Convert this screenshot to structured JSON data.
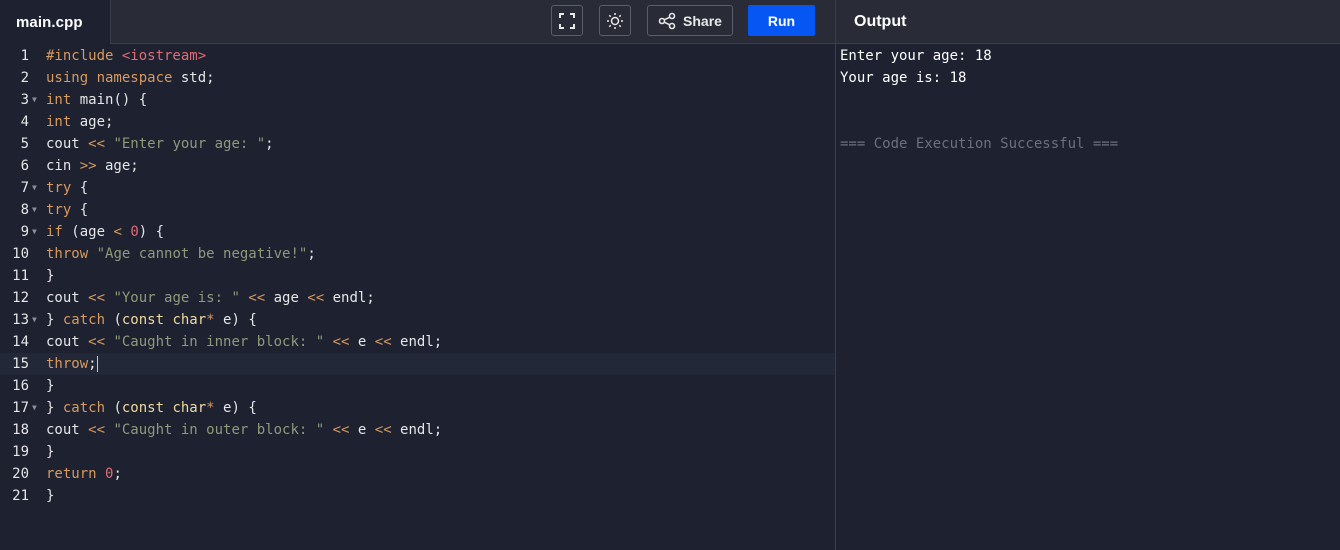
{
  "file_tab": "main.cpp",
  "toolbar": {
    "fullscreen_icon": "fullscreen-icon",
    "theme_icon": "sun-icon",
    "share_label": "Share",
    "run_label": "Run"
  },
  "output_panel": {
    "title": "Output",
    "lines": [
      "Enter your age: 18",
      "Your age is: 18",
      "",
      "",
      "=== Code Execution Successful ==="
    ]
  },
  "editor": {
    "active_line": 15,
    "lines": [
      {
        "n": "1",
        "fold": false,
        "tokens": [
          [
            "pp",
            "#include "
          ],
          [
            "str",
            "<iostream>"
          ]
        ]
      },
      {
        "n": "2",
        "fold": false,
        "tokens": [
          [
            "kw",
            "using namespace"
          ],
          [
            "t",
            " std;"
          ]
        ]
      },
      {
        "n": "3",
        "fold": true,
        "tokens": [
          [
            "kw",
            "int"
          ],
          [
            "t",
            " main() {"
          ]
        ]
      },
      {
        "n": "4",
        "fold": false,
        "tokens": [
          [
            "kw",
            "int"
          ],
          [
            "t",
            " age;"
          ]
        ]
      },
      {
        "n": "5",
        "fold": false,
        "tokens": [
          [
            "t",
            "cout "
          ],
          [
            "op",
            "<<"
          ],
          [
            "t",
            " "
          ],
          [
            "s",
            "\"Enter your age: \""
          ],
          [
            "t",
            ";"
          ]
        ]
      },
      {
        "n": "6",
        "fold": false,
        "tokens": [
          [
            "t",
            "cin "
          ],
          [
            "op",
            ">>"
          ],
          [
            "t",
            " age;"
          ]
        ]
      },
      {
        "n": "7",
        "fold": true,
        "tokens": [
          [
            "kw",
            "try"
          ],
          [
            "t",
            " {"
          ]
        ]
      },
      {
        "n": "8",
        "fold": true,
        "tokens": [
          [
            "kw",
            "try"
          ],
          [
            "t",
            " {"
          ]
        ]
      },
      {
        "n": "9",
        "fold": true,
        "tokens": [
          [
            "kw",
            "if"
          ],
          [
            "t",
            " (age "
          ],
          [
            "op",
            "<"
          ],
          [
            "t",
            " "
          ],
          [
            "num",
            "0"
          ],
          [
            "t",
            ") {"
          ]
        ]
      },
      {
        "n": "10",
        "fold": false,
        "tokens": [
          [
            "kw",
            "throw"
          ],
          [
            "t",
            " "
          ],
          [
            "s",
            "\"Age cannot be negative!\""
          ],
          [
            "t",
            ";"
          ]
        ]
      },
      {
        "n": "11",
        "fold": false,
        "tokens": [
          [
            "t",
            "}"
          ]
        ]
      },
      {
        "n": "12",
        "fold": false,
        "tokens": [
          [
            "t",
            "cout "
          ],
          [
            "op",
            "<<"
          ],
          [
            "t",
            " "
          ],
          [
            "s",
            "\"Your age is: \""
          ],
          [
            "t",
            " "
          ],
          [
            "op",
            "<<"
          ],
          [
            "t",
            " age "
          ],
          [
            "op",
            "<<"
          ],
          [
            "t",
            " endl;"
          ]
        ]
      },
      {
        "n": "13",
        "fold": true,
        "tokens": [
          [
            "t",
            "} "
          ],
          [
            "kw",
            "catch"
          ],
          [
            "t",
            " ("
          ],
          [
            "ty",
            "const char"
          ],
          [
            "op",
            "*"
          ],
          [
            "t",
            " e) {"
          ]
        ]
      },
      {
        "n": "14",
        "fold": false,
        "tokens": [
          [
            "t",
            "cout "
          ],
          [
            "op",
            "<<"
          ],
          [
            "t",
            " "
          ],
          [
            "s",
            "\"Caught in inner block: \""
          ],
          [
            "t",
            " "
          ],
          [
            "op",
            "<<"
          ],
          [
            "t",
            " e "
          ],
          [
            "op",
            "<<"
          ],
          [
            "t",
            " endl;"
          ]
        ]
      },
      {
        "n": "15",
        "fold": false,
        "tokens": [
          [
            "kw",
            "throw"
          ],
          [
            "t",
            ";"
          ]
        ]
      },
      {
        "n": "16",
        "fold": false,
        "tokens": [
          [
            "t",
            "}"
          ]
        ]
      },
      {
        "n": "17",
        "fold": true,
        "tokens": [
          [
            "t",
            "} "
          ],
          [
            "kw",
            "catch"
          ],
          [
            "t",
            " ("
          ],
          [
            "ty",
            "const char"
          ],
          [
            "op",
            "*"
          ],
          [
            "t",
            " e) {"
          ]
        ]
      },
      {
        "n": "18",
        "fold": false,
        "tokens": [
          [
            "t",
            "cout "
          ],
          [
            "op",
            "<<"
          ],
          [
            "t",
            " "
          ],
          [
            "s",
            "\"Caught in outer block: \""
          ],
          [
            "t",
            " "
          ],
          [
            "op",
            "<<"
          ],
          [
            "t",
            " e "
          ],
          [
            "op",
            "<<"
          ],
          [
            "t",
            " endl;"
          ]
        ]
      },
      {
        "n": "19",
        "fold": false,
        "tokens": [
          [
            "t",
            "}"
          ]
        ]
      },
      {
        "n": "20",
        "fold": false,
        "tokens": [
          [
            "kw",
            "return"
          ],
          [
            "t",
            " "
          ],
          [
            "num",
            "0"
          ],
          [
            "t",
            ";"
          ]
        ]
      },
      {
        "n": "21",
        "fold": false,
        "tokens": [
          [
            "t",
            "}"
          ]
        ]
      }
    ]
  },
  "colors": {
    "t": "#e6e6e6",
    "kw": "#d79a5f",
    "pp": "#d79a5f",
    "str": "#e06c75",
    "s": "#8f9a7a",
    "op": "#d79a5f",
    "num": "#e06c75",
    "ty": "#f0d9a0",
    "run_button": "#0556f3"
  }
}
